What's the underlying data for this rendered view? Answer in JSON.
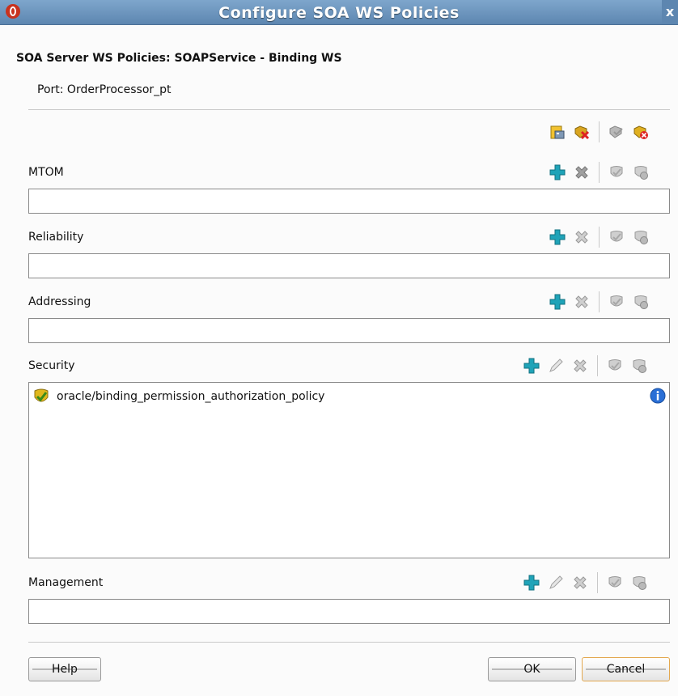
{
  "window": {
    "title": "Configure SOA WS Policies",
    "close_label": "x"
  },
  "header": {
    "title": "SOA Server WS Policies: SOAPService - Binding WS",
    "port": "Port: OrderProcessor_pt"
  },
  "sections": {
    "mtom": {
      "label": "MTOM"
    },
    "reliability": {
      "label": "Reliability"
    },
    "addressing": {
      "label": "Addressing"
    },
    "security": {
      "label": "Security",
      "policies": [
        "oracle/binding_permission_authorization_policy"
      ]
    },
    "management": {
      "label": "Management"
    }
  },
  "buttons": {
    "help": "Help",
    "ok": "OK",
    "cancel": "Cancel"
  },
  "colors": {
    "titlebar": "#6f97c0",
    "add_icon": "#1fa3b8",
    "cancel_border": "#e3a850"
  }
}
